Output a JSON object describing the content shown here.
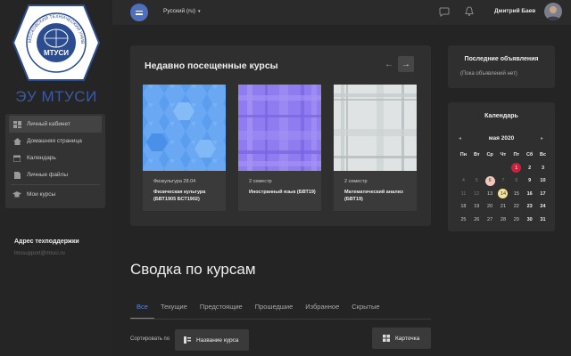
{
  "drawer": {
    "brand": "ЭУ МТУСИ",
    "logo_text": "МТУСИ",
    "logo_ring_text": "МОСКОВСКИЙ ТЕХНИЧЕСКИЙ УНИВЕРСИТЕТ СВЯЗИ И ИНФОРМАТИКИ",
    "nav": [
      {
        "label": "Личный кабинет",
        "icon": "dashboard-icon",
        "active": true
      },
      {
        "label": "Домашняя страница",
        "icon": "home-icon",
        "active": false
      },
      {
        "label": "Календарь",
        "icon": "calendar-icon",
        "active": false
      },
      {
        "label": "Личные файлы",
        "icon": "file-icon",
        "active": false
      },
      {
        "label": "Мои курсы",
        "icon": "graduation-cap-icon",
        "active": false
      }
    ],
    "support_title": "Адрес техподдержки",
    "support_email": "lmssupport@mtuci.ru"
  },
  "topbar": {
    "language": "Русский (ru)",
    "user_name": "Дмитрий Баев",
    "accent": "#4d6fbd"
  },
  "recent": {
    "title": "Недавно посещенные курсы",
    "courses": [
      {
        "category": "Физкультура 28.04",
        "title": "Физическая культура (БВТ1905 БСТ1902)",
        "pattern": "hexagons",
        "color": "#5b9ef0"
      },
      {
        "category": "2 семестр",
        "title": "Иностранный язык (БВТ19)",
        "pattern": "plaid",
        "color": "#8f7cf0"
      },
      {
        "category": "2 семестр",
        "title": "Математический анализ (БВТ19)",
        "pattern": "plaid",
        "color": "#dfe3e4"
      }
    ]
  },
  "announcements": {
    "title": "Последние объявления",
    "empty": "(Пока объявлений нет)"
  },
  "calendar": {
    "title": "Календарь",
    "month": "мая 2020",
    "weekdays": [
      "Пн",
      "Вт",
      "Ср",
      "Чт",
      "Пт",
      "Сб",
      "Вс"
    ],
    "weeks": [
      [
        "",
        "",
        "",
        "",
        "1",
        "2",
        "3"
      ],
      [
        "4",
        "5",
        "6",
        "7",
        "8",
        "9",
        "10"
      ],
      [
        "11",
        "12",
        "13",
        "14",
        "15",
        "16",
        "17"
      ],
      [
        "18",
        "19",
        "20",
        "21",
        "22",
        "23",
        "24"
      ],
      [
        "25",
        "26",
        "27",
        "28",
        "29",
        "30",
        "31"
      ]
    ],
    "highlights": {
      "1": "red",
      "6": "pink",
      "14": "yellow"
    }
  },
  "overview": {
    "title": "Сводка по курсам",
    "tabs": [
      "Все",
      "Текущие",
      "Предстоящие",
      "Прошедшие",
      "Избранное",
      "Скрытые"
    ],
    "active_tab": 0,
    "sort_label": "Сортировать по",
    "sort_value": "Название курса",
    "view_value": "Карточка"
  }
}
